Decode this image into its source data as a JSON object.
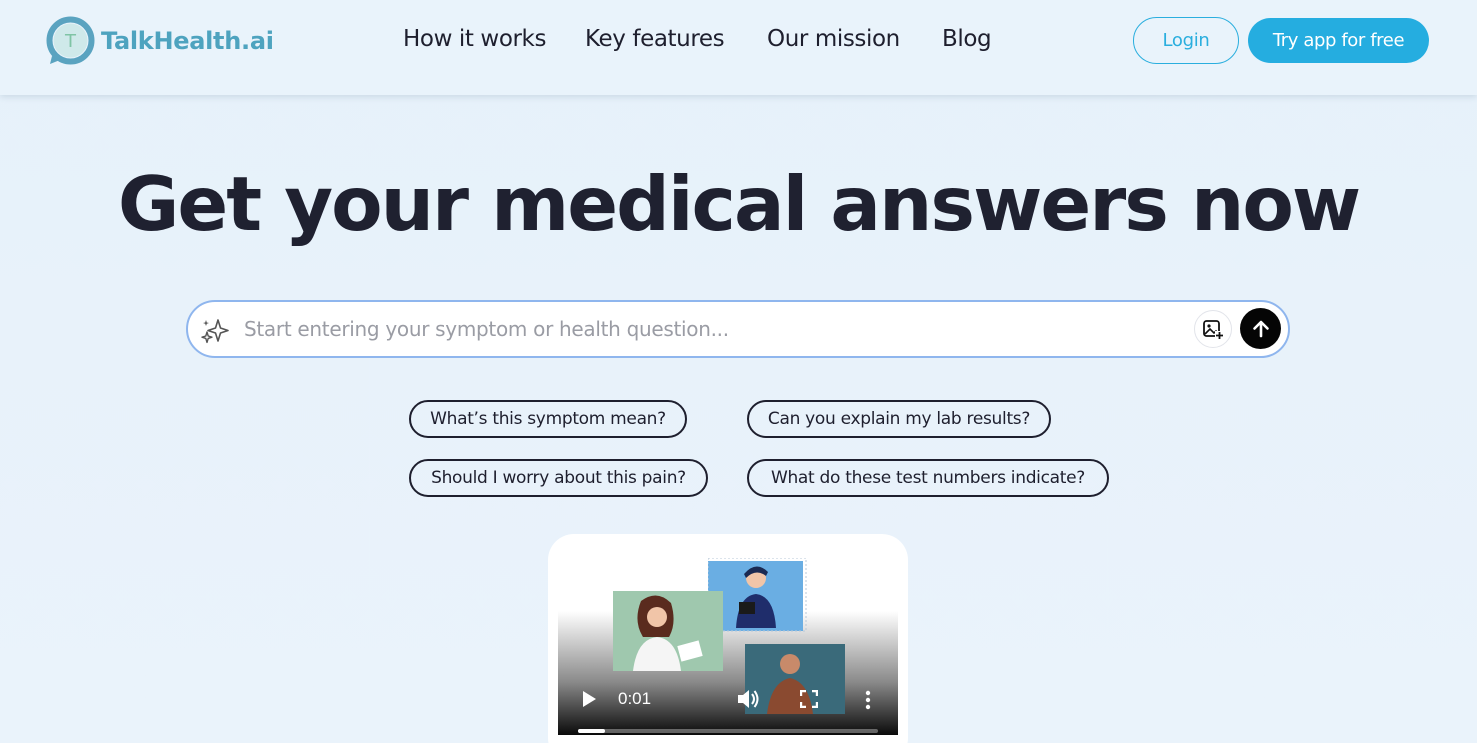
{
  "brand": {
    "name": "TalkHealth.ai",
    "logo_letter": "T",
    "primary_color": "#4ea3bf",
    "accent_color": "#25ade0"
  },
  "nav": {
    "items": [
      {
        "label": "How it works"
      },
      {
        "label": "Key features"
      },
      {
        "label": "Our mission"
      },
      {
        "label": "Blog"
      }
    ]
  },
  "header_actions": {
    "login_label": "Login",
    "try_label": "Try app for free"
  },
  "hero": {
    "title": "Get your medical answers now"
  },
  "search": {
    "placeholder": "Start entering your symptom or health question...",
    "value": "",
    "sparkle_icon": "sparkle-icon",
    "image_icon": "add-image-icon",
    "send_icon": "arrow-up-icon"
  },
  "suggestions": [
    {
      "label": "What’s this symptom mean?"
    },
    {
      "label": "Can you explain my lab results?"
    },
    {
      "label": "Should I worry about this pain?"
    },
    {
      "label": "What do these test numbers indicate?"
    }
  ],
  "video": {
    "time": "0:01",
    "progress": 0.09,
    "icons": [
      "play-icon",
      "volume-icon",
      "fullscreen-icon",
      "more-options-icon"
    ]
  }
}
